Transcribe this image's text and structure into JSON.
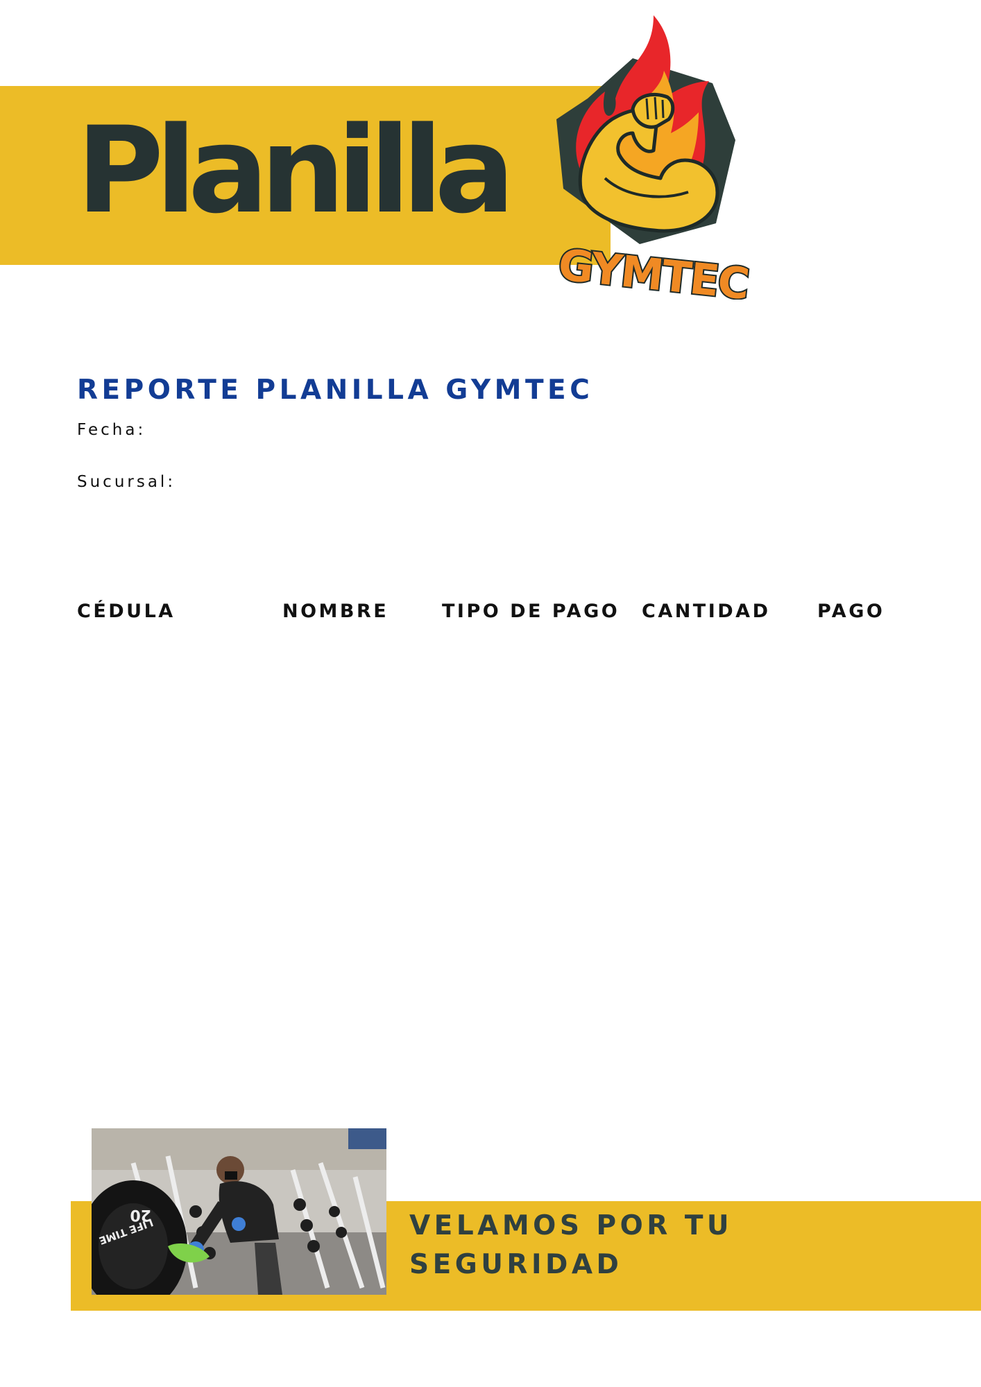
{
  "header": {
    "title": "Planilla",
    "logo_text": "GYMTEC"
  },
  "report": {
    "title": "REPORTE PLANILLA GYMTEC",
    "date_label": "Fecha:",
    "branch_label": "Sucursal:"
  },
  "table": {
    "columns": [
      "CÉDULA",
      "NOMBRE",
      "TIPO DE PAGO",
      "CANTIDAD",
      "PAGO"
    ]
  },
  "footer": {
    "slogan_line1": "VELAMOS POR TU",
    "slogan_line2": "SEGURIDAD",
    "photo_weight_text": "20",
    "photo_brand_text": "LIFE TIME"
  },
  "colors": {
    "accent_yellow": "#ECBC27",
    "title_dark": "#263333",
    "report_blue": "#123C94",
    "logo_orange": "#F08A24",
    "logo_red": "#E8262A"
  }
}
